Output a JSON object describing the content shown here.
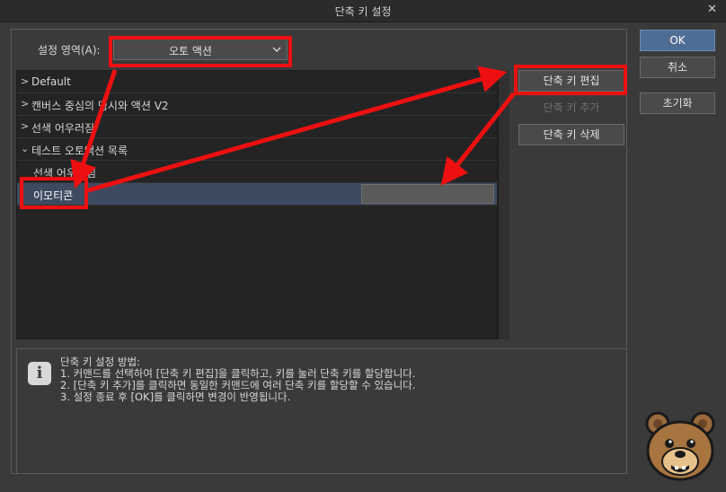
{
  "window": {
    "title": "단축 키 설정"
  },
  "scope": {
    "label": "설정 영역(A):",
    "value": "오토 액션"
  },
  "tree": {
    "rows": [
      {
        "label": "Default",
        "arrow": ">"
      },
      {
        "label": "캔버스 중심의 명시와 액션 V2",
        "arrow": ">"
      },
      {
        "label": "선색 어우러짐",
        "arrow": ">"
      },
      {
        "label": "테스트 오토액션 목록",
        "arrow": "⌄"
      },
      {
        "label": "선색 어우러짐",
        "arrow": ""
      },
      {
        "label": "이모티콘",
        "arrow": ""
      }
    ]
  },
  "side_buttons": {
    "edit": "단축 키 편집",
    "add": "단축 키 추가",
    "delete": "단축 키 삭제"
  },
  "right_buttons": {
    "ok": "OK",
    "cancel": "취소",
    "reset": "초기화"
  },
  "info": {
    "title": "단축 키 설정 방법:",
    "lines": [
      "1. 커맨드를 선택하여 [단축 키 편집]을 클릭하고, 키를 눌러 단축 키를 할당합니다.",
      "2. [단축 키 추가]를 클릭하면 동일한 커맨드에 여러 단축 키를 할당할 수 있습니다.",
      "3. 설정 종료 후 [OK]를 클릭하면 변경이 반영됩니다."
    ]
  },
  "colors": {
    "annotation": "#ee1010",
    "selection": "#3e4a60",
    "ok_button": "#4f6e96"
  }
}
